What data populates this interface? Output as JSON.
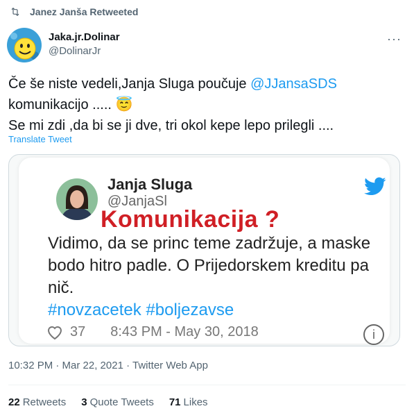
{
  "retweet_label": "Janez Janša Retweeted",
  "author": {
    "display_name": "Jaka.jr.Dolinar",
    "handle": "@DolinarJr"
  },
  "more_label": "···",
  "tweet": {
    "line1_prefix": "Če še niste vedeli,Janja Sluga poučuje ",
    "line1_mention": "@JJansaSDS",
    "line2": "komunikacijo .....",
    "emoji": "😇",
    "line3": "Se mi zdi ,da bi se ji dve, tri okol kepe lepo prilegli ...."
  },
  "translate_label": "Translate Tweet",
  "embedded": {
    "name": "Janja Sluga",
    "handle": "@JanjaSl",
    "headline": "Komunikacija ?",
    "body": "Vidimo, da se princ teme zadržuje, a maske bodo hitro padle. O Prijedorskem kreditu pa nič.",
    "tags": "#novzacetek #boljezavse",
    "likes": "37",
    "timestamp": "8:43 PM - May 30, 2018",
    "info": "i"
  },
  "meta": "10:32 PM · Mar 22, 2021 · Twitter Web App",
  "stats": {
    "retweets_count": "22",
    "retweets_label": "Retweets",
    "quotes_count": "3",
    "quotes_label": "Quote Tweets",
    "likes_count": "71",
    "likes_label": "Likes"
  },
  "colors": {
    "accent": "#1d9bf0",
    "headline": "#d01f25"
  }
}
